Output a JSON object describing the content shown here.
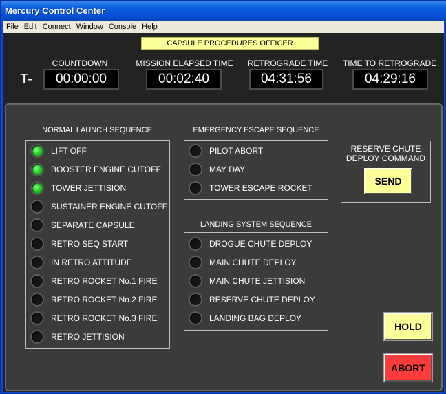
{
  "window": {
    "title": "Mercury Control Center"
  },
  "menu": [
    "File",
    "Edit",
    "Connect",
    "Window",
    "Console",
    "Help"
  ],
  "officer_label": "CAPSULE PROCEDURES OFFICER",
  "t_prefix": "T-",
  "timers": [
    {
      "label": "COUNTDOWN",
      "value": "00:00:00"
    },
    {
      "label": "MISSION ELAPSED TIME",
      "value": "00:02:40"
    },
    {
      "label": "RETROGRADE TIME",
      "value": "04:31:56"
    },
    {
      "label": "TIME TO RETROGRADE",
      "value": "04:29:16"
    }
  ],
  "normal_launch": {
    "title": "NORMAL LAUNCH SEQUENCE",
    "items": [
      {
        "label": "LIFT OFF",
        "on": true
      },
      {
        "label": "BOOSTER ENGINE CUTOFF",
        "on": true
      },
      {
        "label": "TOWER JETTISION",
        "on": true
      },
      {
        "label": "SUSTAINER ENGINE CUTOFF",
        "on": false
      },
      {
        "label": "SEPARATE CAPSULE",
        "on": false
      },
      {
        "label": "RETRO SEQ START",
        "on": false
      },
      {
        "label": "IN RETRO ATTITUDE",
        "on": false
      },
      {
        "label": "RETRO ROCKET No.1 FIRE",
        "on": false
      },
      {
        "label": "RETRO ROCKET No.2 FIRE",
        "on": false
      },
      {
        "label": "RETRO ROCKET No.3 FIRE",
        "on": false
      },
      {
        "label": "RETRO JETTISION",
        "on": false
      }
    ]
  },
  "emergency": {
    "title": "EMERGENCY ESCAPE SEQUENCE",
    "items": [
      {
        "label": "PILOT ABORT",
        "on": false
      },
      {
        "label": "MAY DAY",
        "on": false
      },
      {
        "label": "TOWER ESCAPE ROCKET",
        "on": false
      }
    ]
  },
  "landing": {
    "title": "LANDING SYSTEM  SEQUENCE",
    "items": [
      {
        "label": "DROGUE CHUTE DEPLOY",
        "on": false
      },
      {
        "label": "MAIN CHUTE DEPLOY",
        "on": false
      },
      {
        "label": "MAIN CHUTE JETTISION",
        "on": false
      },
      {
        "label": "RESERVE CHUTE DEPLOY",
        "on": false
      },
      {
        "label": "LANDING BAG DEPLOY",
        "on": false
      }
    ]
  },
  "reserve": {
    "line1": "RESERVE CHUTE",
    "line2": "DEPLOY COMMAND",
    "send": "SEND"
  },
  "hold": "HOLD",
  "abort": "ABORT",
  "colors": {
    "indicator_on": "#19c019",
    "title_bar": "#0a5fe0",
    "send_hold": "#ffff99",
    "abort": "#ff3b3b"
  }
}
